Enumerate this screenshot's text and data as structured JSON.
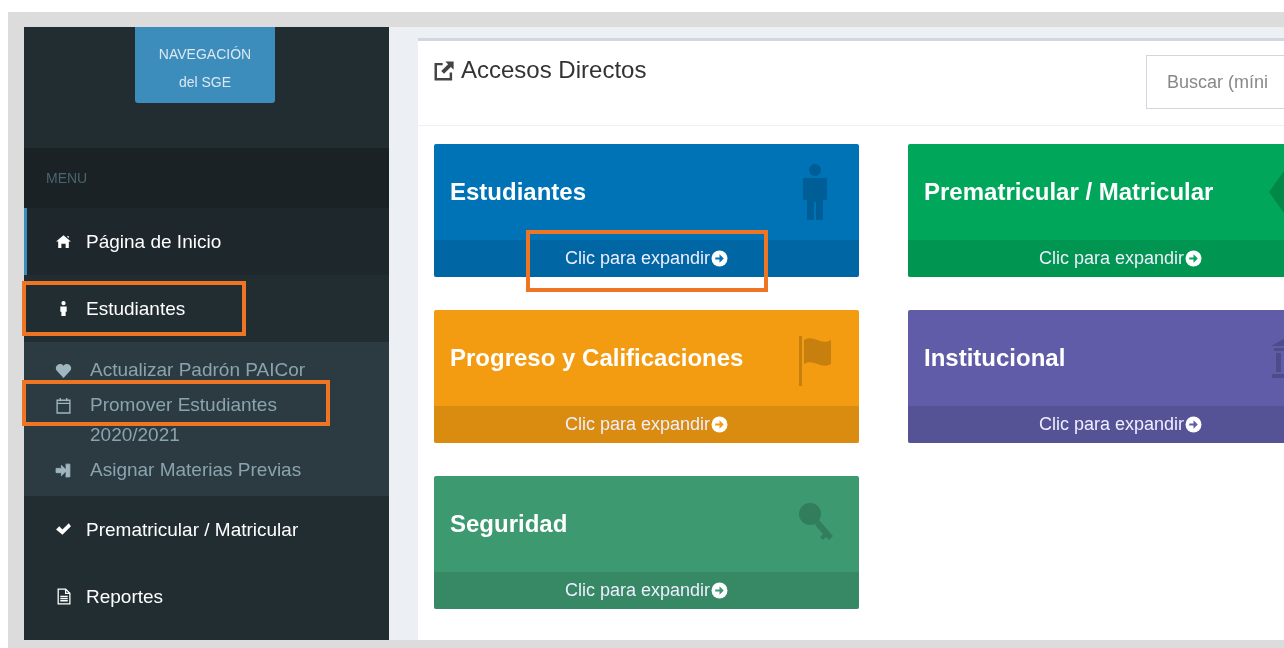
{
  "sidebar": {
    "logo": {
      "lines": [
        "NAVEGACIÓN",
        "del SGE"
      ]
    },
    "menu_header": "MENU",
    "items": [
      {
        "label": "Página de Inicio",
        "kind": "home",
        "selected": true,
        "highlighted": false
      },
      {
        "label": "Estudiantes",
        "kind": "person",
        "selected": false,
        "highlighted": true,
        "children": [
          {
            "label": "Actualizar Padrón PAICor",
            "kind": "heart",
            "highlighted": false
          },
          {
            "label": "Promover Estudiantes 2020/2021",
            "kind": "calendar",
            "highlighted": true
          },
          {
            "label": "Asignar Materias Previas",
            "kind": "sign-in",
            "highlighted": false
          }
        ]
      },
      {
        "label": "Prematricular / Matricular",
        "kind": "check",
        "selected": false,
        "highlighted": false
      },
      {
        "label": "Reportes",
        "kind": "file",
        "selected": false,
        "highlighted": false
      }
    ]
  },
  "panel": {
    "title": "Accesos Directos",
    "search": {
      "placeholder": "Buscar (míni"
    },
    "cards": [
      {
        "title": "Estudiantes",
        "kind": "person",
        "color": "#0073b7",
        "link": "Clic para expandir",
        "highlighted": true
      },
      {
        "title": "Prematricular / Matricular",
        "kind": "diamond",
        "color": "#00a65a",
        "link": "Clic para expandir",
        "highlighted": false
      },
      {
        "title": "Progreso y Calificaciones",
        "kind": "flag",
        "color": "#f39c12",
        "link": "Clic para expandir",
        "highlighted": false
      },
      {
        "title": "Institucional",
        "kind": "bank",
        "color": "#605ca8",
        "link": "Clic para expandir",
        "highlighted": false
      },
      {
        "title": "Seguridad",
        "kind": "key",
        "color": "#3d9970",
        "link": "Clic para expandir",
        "highlighted": false
      }
    ]
  }
}
